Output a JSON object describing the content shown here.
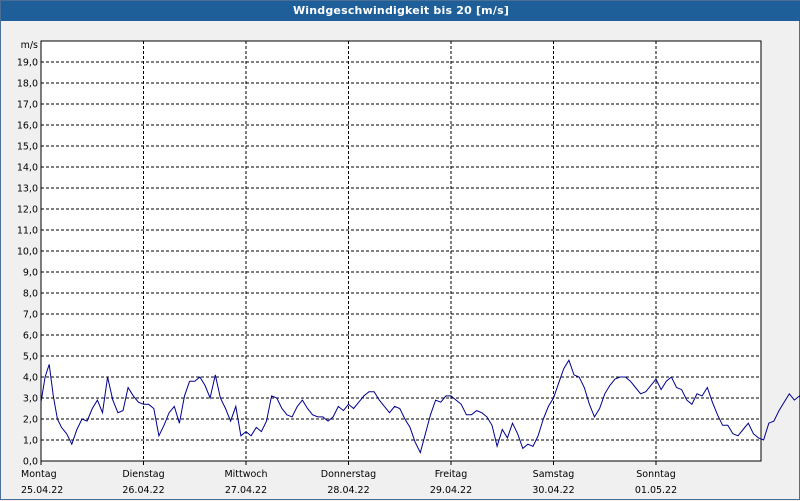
{
  "title": "Windgeschwindigkeit bis 20 [m/s]",
  "chart_data": {
    "type": "line",
    "title": "Windgeschwindigkeit bis 20 [m/s]",
    "ylabel": "m/s",
    "xlabel": "",
    "ylim": [
      0,
      20
    ],
    "grid": true,
    "yticks": [
      "0,0",
      "1,0",
      "2,0",
      "3,0",
      "4,0",
      "5,0",
      "6,0",
      "7,0",
      "8,0",
      "9,0",
      "10,0",
      "11,0",
      "12,0",
      "13,0",
      "14,0",
      "15,0",
      "16,0",
      "17,0",
      "18,0",
      "19,0"
    ],
    "days": [
      {
        "name": "Montag",
        "date": "25.04.22"
      },
      {
        "name": "Dienstag",
        "date": "26.04.22"
      },
      {
        "name": "Mittwoch",
        "date": "27.04.22"
      },
      {
        "name": "Donnerstag",
        "date": "28.04.22"
      },
      {
        "name": "Freitag",
        "date": "29.04.22"
      },
      {
        "name": "Samstag",
        "date": "30.04.22"
      },
      {
        "name": "Sonntag",
        "date": "01.05.22"
      }
    ],
    "series": [
      {
        "color": "#00008b",
        "x": [
          0,
          0.04,
          0.08,
          0.12,
          0.16,
          0.2,
          0.25,
          0.3,
          0.35,
          0.4,
          0.45,
          0.5,
          0.55,
          0.6,
          0.65,
          0.7,
          0.75,
          0.8,
          0.85,
          0.9,
          0.95,
          1.0,
          1.05,
          1.1,
          1.15,
          1.2,
          1.25,
          1.3,
          1.35,
          1.4,
          1.45,
          1.5,
          1.55,
          1.6,
          1.65,
          1.7,
          1.75,
          1.8,
          1.85,
          1.9,
          1.95,
          2.0,
          2.05,
          2.1,
          2.15,
          2.2,
          2.25,
          2.3,
          2.35,
          2.4,
          2.45,
          2.5,
          2.55,
          2.6,
          2.65,
          2.7,
          2.75,
          2.8,
          2.85,
          2.9,
          2.95,
          3.0,
          3.05,
          3.1,
          3.15,
          3.2,
          3.25,
          3.3,
          3.35,
          3.4,
          3.45,
          3.5,
          3.55,
          3.6,
          3.65,
          3.7,
          3.75,
          3.8,
          3.85,
          3.9,
          3.95,
          4.0,
          4.05,
          4.1,
          4.15,
          4.2,
          4.25,
          4.3,
          4.35,
          4.4,
          4.45,
          4.5,
          4.55,
          4.6,
          4.65,
          4.7,
          4.75,
          4.8,
          4.85,
          4.9,
          4.95,
          5.0,
          5.05,
          5.1,
          5.15,
          5.2,
          5.25,
          5.3,
          5.35,
          5.4,
          5.45,
          5.5,
          5.55,
          5.6,
          5.65,
          5.7,
          5.75,
          5.8,
          5.85,
          5.9,
          5.95,
          6.0,
          6.05,
          6.1,
          6.15,
          6.2,
          6.25,
          6.3,
          6.35,
          6.4,
          6.45,
          6.5,
          6.55,
          6.6,
          6.65,
          6.7,
          6.75,
          6.8,
          6.85,
          6.9,
          6.95,
          7.0,
          7.05,
          7.1,
          7.15
        ],
        "values": [
          2.8,
          4.0,
          4.6,
          3.1,
          2.0,
          1.6,
          1.3,
          0.8,
          1.5,
          2.0,
          1.9,
          2.5,
          2.9,
          2.3,
          4.0,
          2.9,
          2.3,
          2.4,
          3.5,
          3.1,
          2.8,
          2.7,
          2.7,
          2.5,
          1.2,
          1.7,
          2.3,
          2.6,
          1.8,
          3.1,
          3.8,
          3.8,
          4.0,
          3.6,
          3.0,
          4.1,
          3.0,
          2.5,
          1.9,
          2.6,
          1.2,
          1.4,
          1.2,
          1.6,
          1.4,
          1.9,
          3.1,
          3.0,
          2.5,
          2.2,
          2.1,
          2.6,
          2.9,
          2.5,
          2.2,
          2.1,
          2.1,
          1.9,
          2.1,
          2.6,
          2.4,
          2.7,
          2.5,
          2.8,
          3.1,
          3.3,
          3.3,
          2.9,
          2.6,
          2.3,
          2.6,
          2.5,
          2.0,
          1.6,
          0.9,
          0.4,
          1.3,
          2.2,
          2.9,
          2.8,
          3.1,
          3.1,
          2.9,
          2.7,
          2.2,
          2.2,
          2.4,
          2.3,
          2.1,
          1.7,
          0.7,
          1.5,
          1.1,
          1.8,
          1.3,
          0.6,
          0.8,
          0.7,
          1.2,
          2.0,
          2.6,
          3.0,
          3.7,
          4.4,
          4.8,
          4.1,
          4.0,
          3.5,
          2.7,
          2.1,
          2.5,
          3.2,
          3.6,
          3.9,
          4.0,
          4.0,
          3.8,
          3.5,
          3.2,
          3.3,
          3.6,
          3.9,
          3.4,
          3.8,
          4.0,
          3.5,
          3.4,
          2.9,
          2.7,
          3.2,
          3.1,
          3.5,
          2.8,
          2.2,
          1.7,
          1.7,
          1.3,
          1.2,
          1.5,
          1.8,
          1.3,
          1.1,
          1.0,
          1.8,
          1.9
        ],
        "values_cont": [
          2.4,
          2.8,
          3.2,
          2.9,
          3.1,
          2.8,
          2.9,
          3.3,
          3.0,
          2.4,
          2.6,
          2.8,
          3.0,
          2.8
        ]
      }
    ]
  }
}
